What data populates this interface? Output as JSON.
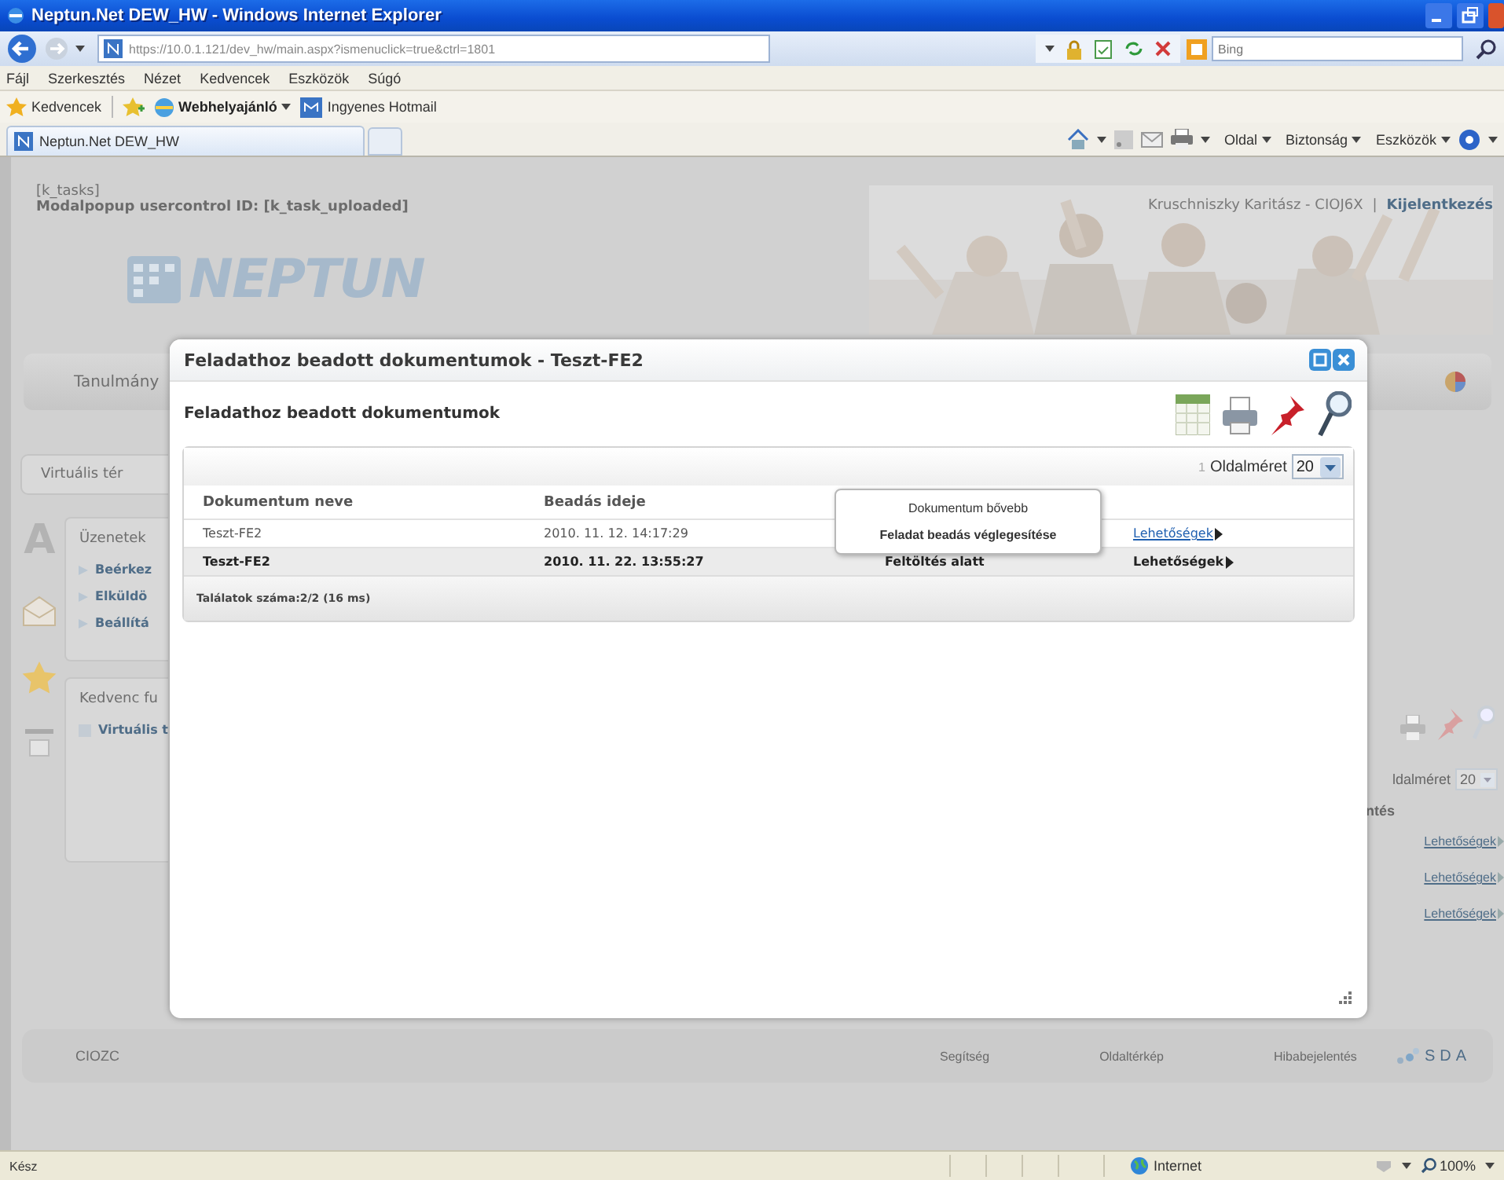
{
  "window": {
    "title": "Neptun.Net DEW_HW - Windows Internet Explorer"
  },
  "address_bar": {
    "url": "https://10.0.1.121/dev_hw/main.aspx?ismenuclick=true&ctrl=1801",
    "search_placeholder": "Bing"
  },
  "menu_bar": [
    "Fájl",
    "Szerkesztés",
    "Nézet",
    "Kedvencek",
    "Eszközök",
    "Súgó"
  ],
  "favorites_bar": {
    "title": "Kedvencek",
    "items": [
      {
        "label": "Webhelyajánló",
        "kind": "dropdown"
      },
      {
        "label": "Ingyenes Hotmail",
        "kind": "link"
      }
    ]
  },
  "tabs": [
    {
      "label": "Neptun.Net DEW_HW",
      "selected": true
    }
  ],
  "command_bar": [
    "Oldal",
    "Biztonság",
    "Eszközök"
  ],
  "page": {
    "debug_lines": [
      "[k_tasks]",
      "Modalpopup usercontrol ID: [k_task_uploaded]"
    ],
    "user": "Kruschniszky Karitász - CIOJ6X",
    "user_separator": "|",
    "logout": "Kijelentkezés",
    "logo": "NEPTUN",
    "nav_tab": "Tanulmány",
    "left_tab": "Virtuális tér",
    "side_letter": "A",
    "messages": {
      "title": "Üzenetek",
      "items": [
        "Beérkez",
        "Elküldö",
        "Beállítá"
      ]
    },
    "favorites": {
      "title": "Kedvenc fu",
      "items": [
        "Virtuális t"
      ]
    },
    "right_panel": {
      "page_size_label": "ldalméret",
      "page_size": "20",
      "column": "ntés",
      "links": [
        "Lehetőségek",
        "Lehetőségek",
        "Lehetőségek"
      ]
    },
    "footer": {
      "code": "CIOZC",
      "links": [
        "Segítség",
        "Oldaltérkép",
        "Hibabejelentés"
      ],
      "vendor": "SDA"
    }
  },
  "modal": {
    "title": "Feladathoz beadott dokumentumok - Teszt-FE2",
    "heading": "Feladathoz beadott dokumentumok",
    "pager": {
      "page": "1",
      "label": "Oldalméret",
      "page_size": "20"
    },
    "columns": [
      "Dokumentum neve",
      "Beadás ideje"
    ],
    "rows": [
      {
        "name": "Teszt-FE2",
        "submitted": "2010. 11. 12. 14:17:29",
        "options": "Lehetőségek",
        "selected": false,
        "menu_open": true
      },
      {
        "name": "Teszt-FE2",
        "submitted": "2010. 11. 22. 13:55:27",
        "status": "Feltöltés alatt",
        "options": "Lehetőségek",
        "selected": true,
        "menu_open": false
      }
    ],
    "summary": "Találatok száma:2/2 (16 ms)",
    "context_menu": [
      "Dokumentum bővebb",
      "Feladat beadás véglegesítése"
    ]
  },
  "status_bar": {
    "text": "Kész",
    "zone": "Internet",
    "zoom": "100%"
  }
}
